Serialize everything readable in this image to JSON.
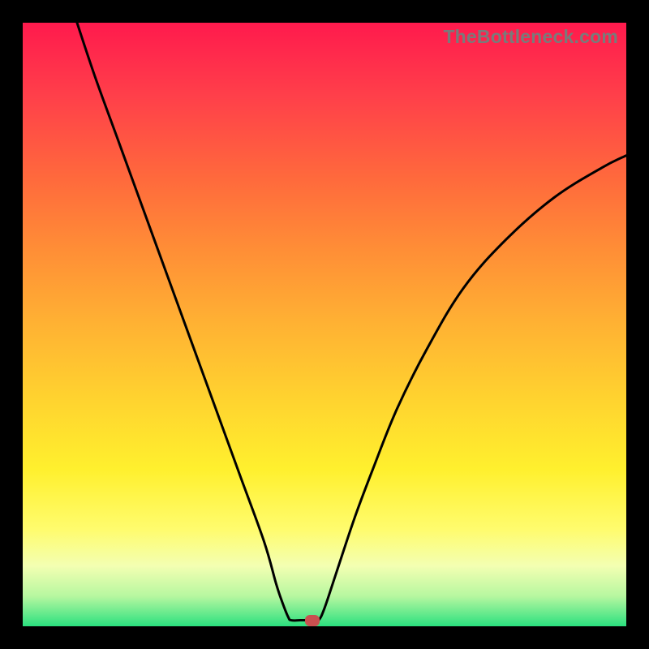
{
  "watermark": {
    "text": "TheBottleneck.com"
  },
  "colors": {
    "frame_bg": "#000000",
    "curve_stroke": "#000000",
    "marker_fill": "#c95050",
    "gradient_stops": [
      "#ff1a4d",
      "#ff3f4a",
      "#ff6a3c",
      "#ff8f36",
      "#ffb233",
      "#ffd22f",
      "#fff02e",
      "#fffc6e",
      "#f3ffb2",
      "#b7f7a0",
      "#2be07f"
    ]
  },
  "chart_data": {
    "type": "line",
    "title": "",
    "xlabel": "",
    "ylabel": "",
    "xlim": [
      0,
      100
    ],
    "ylim": [
      0,
      100
    ],
    "grid": false,
    "legend": false,
    "series": [
      {
        "name": "left-branch",
        "x": [
          9,
          12,
          16,
          20,
          24,
          28,
          32,
          36,
          40,
          42,
          43,
          44,
          44.5
        ],
        "y": [
          100,
          91,
          80,
          69,
          58,
          47,
          36,
          25,
          14,
          7,
          4,
          1.5,
          1
        ]
      },
      {
        "name": "valley-floor",
        "x": [
          44.5,
          46,
          48,
          49
        ],
        "y": [
          1,
          1,
          1,
          1
        ]
      },
      {
        "name": "right-branch",
        "x": [
          49,
          50,
          52,
          55,
          58,
          62,
          67,
          73,
          80,
          88,
          96,
          100
        ],
        "y": [
          1,
          3,
          9,
          18,
          26,
          36,
          46,
          56,
          64,
          71,
          76,
          78
        ]
      }
    ],
    "marker": {
      "x": 48,
      "y": 1
    },
    "annotations": []
  }
}
